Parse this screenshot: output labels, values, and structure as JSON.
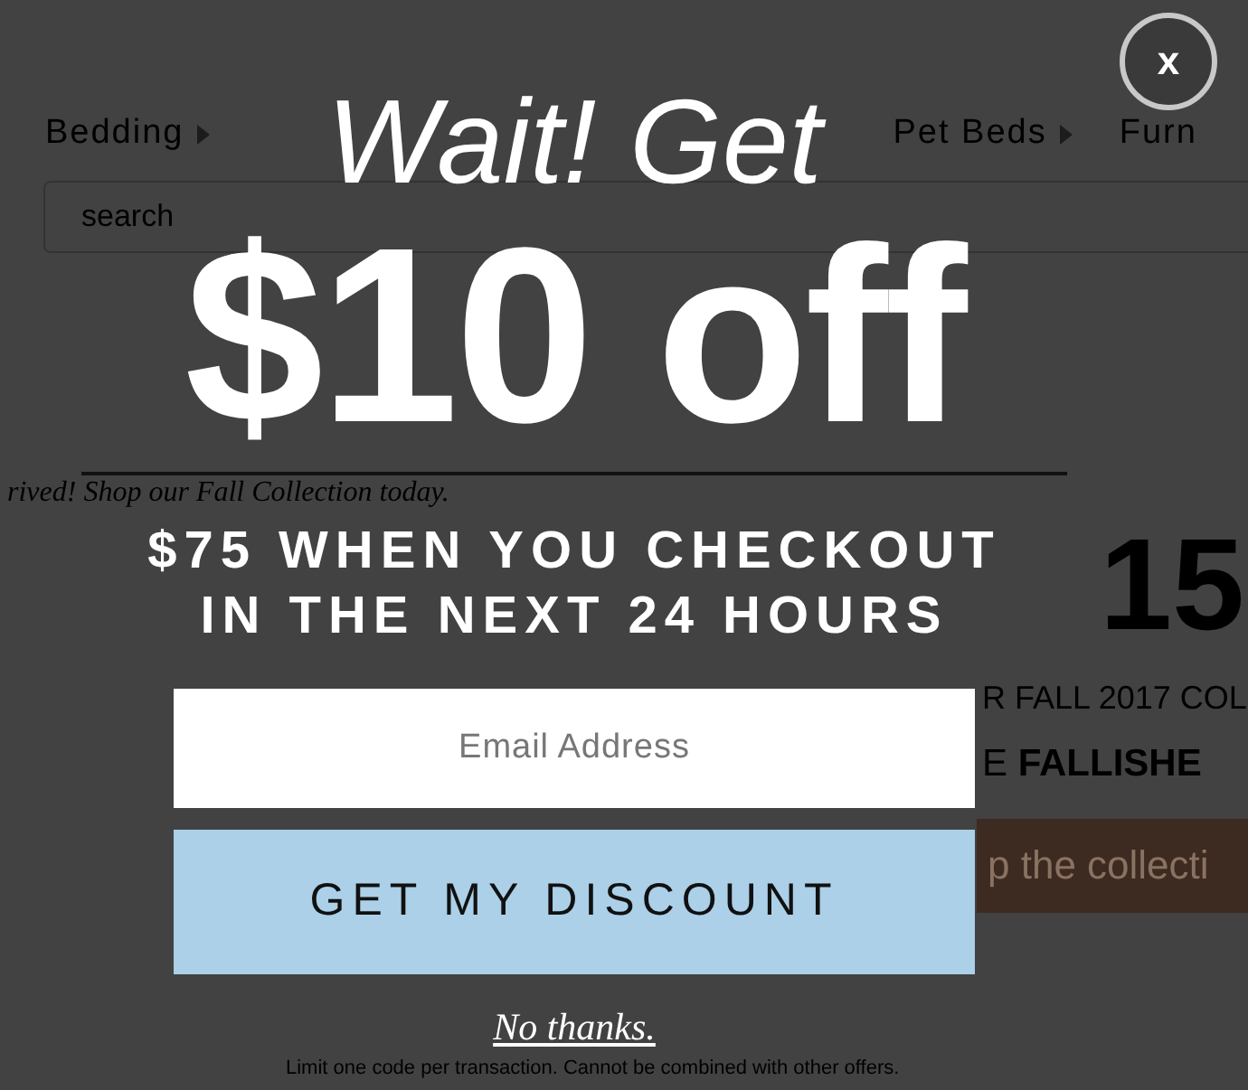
{
  "background_page": {
    "nav_items": [
      {
        "label": "Bedding",
        "has_submenu": true
      },
      {
        "label": "Pet Beds",
        "has_submenu": true
      },
      {
        "label": "Furn",
        "has_submenu": false
      }
    ],
    "search": {
      "placeholder": "search"
    },
    "banner": "rived! Shop our Fall Collection today.",
    "headline": "15",
    "subline": "R FALL 2017 COL",
    "code_line": "E **FALLISHE**",
    "cta": "p the collecti",
    "fine_print": "Limit one code per transaction. Cannot be combined with other offers."
  },
  "popup": {
    "close": "x",
    "title": "Wait! Get",
    "offer": "$10 off",
    "conditions": [
      "$75 WHEN YOU CHECKOUT",
      "IN THE NEXT 24 HOURS"
    ],
    "email": {
      "placeholder": "Email Address"
    },
    "submit": "GET MY DISCOUNT",
    "decline": "No thanks."
  }
}
